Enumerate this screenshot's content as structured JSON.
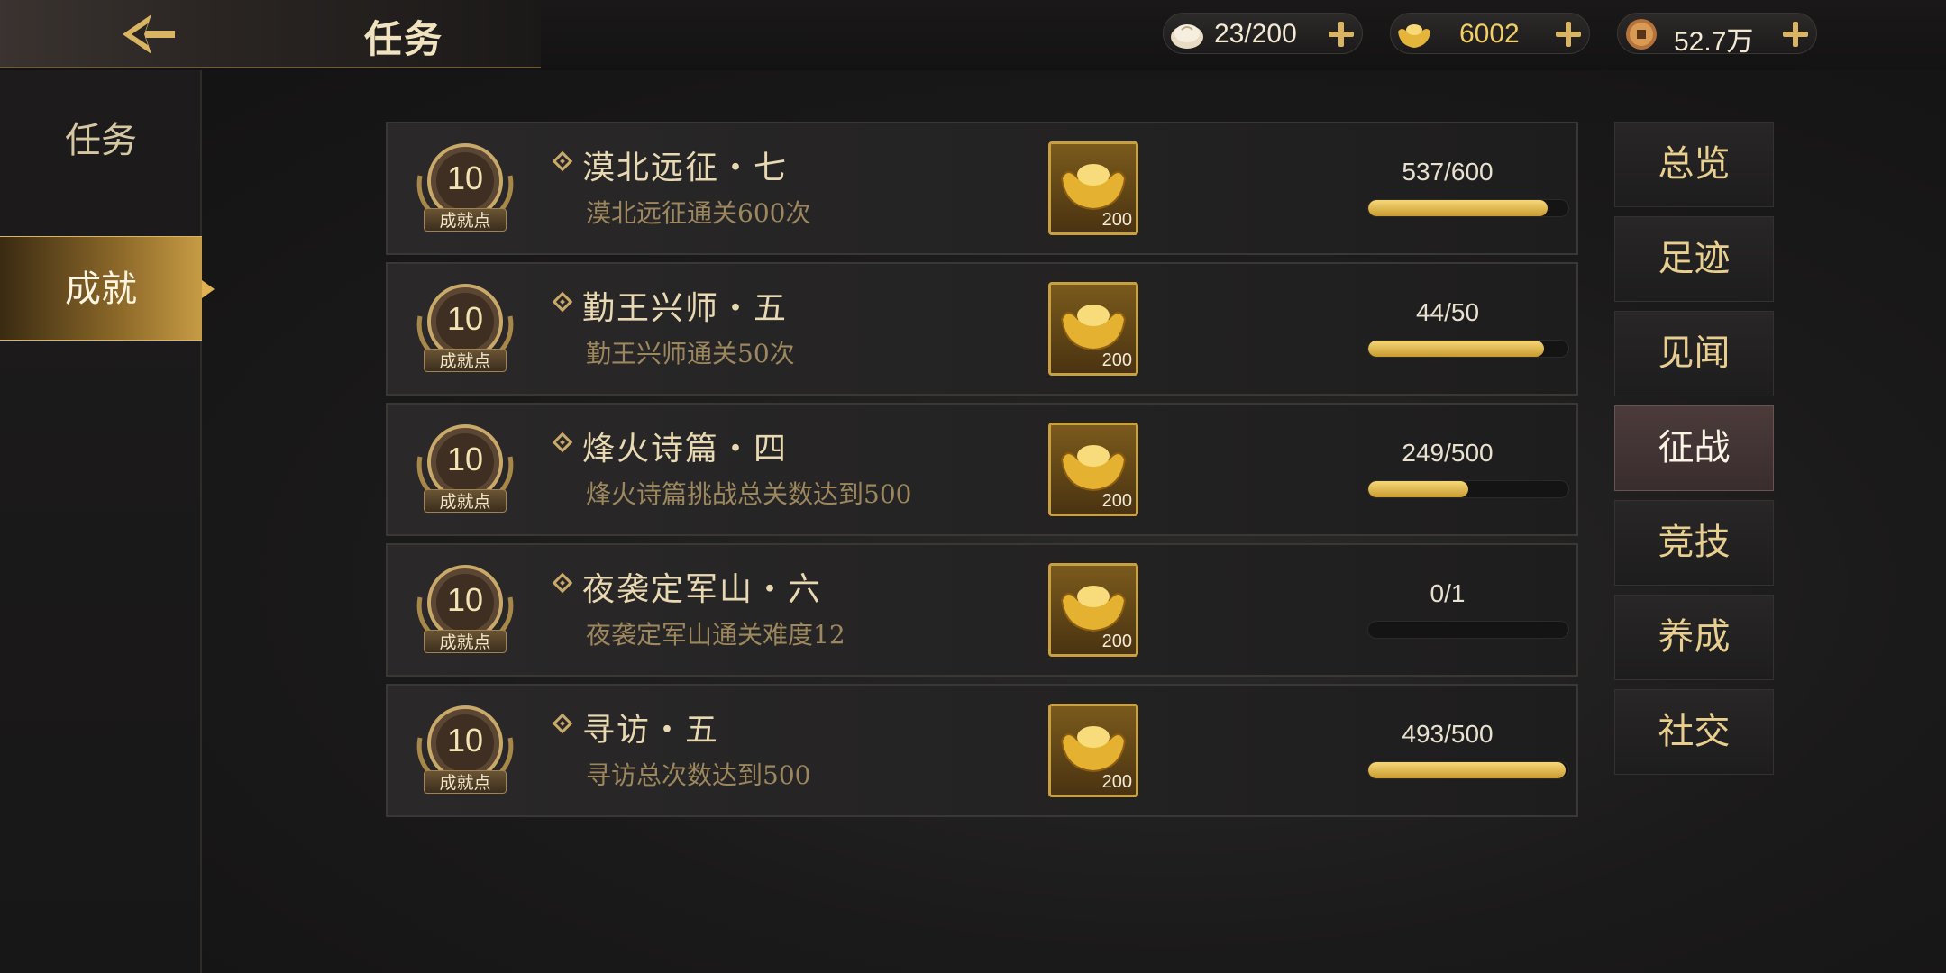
{
  "header": {
    "title": "任务",
    "resources": [
      {
        "icon": "bun-icon",
        "value": "23/200",
        "highlight": false
      },
      {
        "icon": "gold-ingot-icon",
        "value": "6002",
        "highlight": true
      },
      {
        "icon": "copper-coin-icon",
        "value": "52.7万",
        "highlight": false
      }
    ]
  },
  "sidebar": {
    "tabs": [
      {
        "label": "任务",
        "active": false
      },
      {
        "label": "成就",
        "active": true
      }
    ]
  },
  "tasks": [
    {
      "points": "10",
      "points_label": "成就点",
      "title": "漠北远征・七",
      "desc": "漠北远征通关600次",
      "reward_amount": "200",
      "progress_text": "537/600",
      "progress": 0.895
    },
    {
      "points": "10",
      "points_label": "成就点",
      "title": "勤王兴师・五",
      "desc": "勤王兴师通关50次",
      "reward_amount": "200",
      "progress_text": "44/50",
      "progress": 0.88
    },
    {
      "points": "10",
      "points_label": "成就点",
      "title": "烽火诗篇・四",
      "desc": "烽火诗篇挑战总关数达到500",
      "reward_amount": "200",
      "progress_text": "249/500",
      "progress": 0.498
    },
    {
      "points": "10",
      "points_label": "成就点",
      "title": "夜袭定军山・六",
      "desc": "夜袭定军山通关难度12",
      "reward_amount": "200",
      "progress_text": "0/1",
      "progress": 0
    },
    {
      "points": "10",
      "points_label": "成就点",
      "title": "寻访・五",
      "desc": "寻访总次数达到500",
      "reward_amount": "200",
      "progress_text": "493/500",
      "progress": 0.986
    }
  ],
  "categories": [
    {
      "label": "总览",
      "active": false
    },
    {
      "label": "足迹",
      "active": false
    },
    {
      "label": "见闻",
      "active": false
    },
    {
      "label": "征战",
      "active": true
    },
    {
      "label": "竞技",
      "active": false
    },
    {
      "label": "养成",
      "active": false
    },
    {
      "label": "社交",
      "active": false
    }
  ],
  "colors": {
    "accent_gold": "#d9b463",
    "progress_fill": "#f2cf63",
    "background": "#1b1a1a"
  }
}
